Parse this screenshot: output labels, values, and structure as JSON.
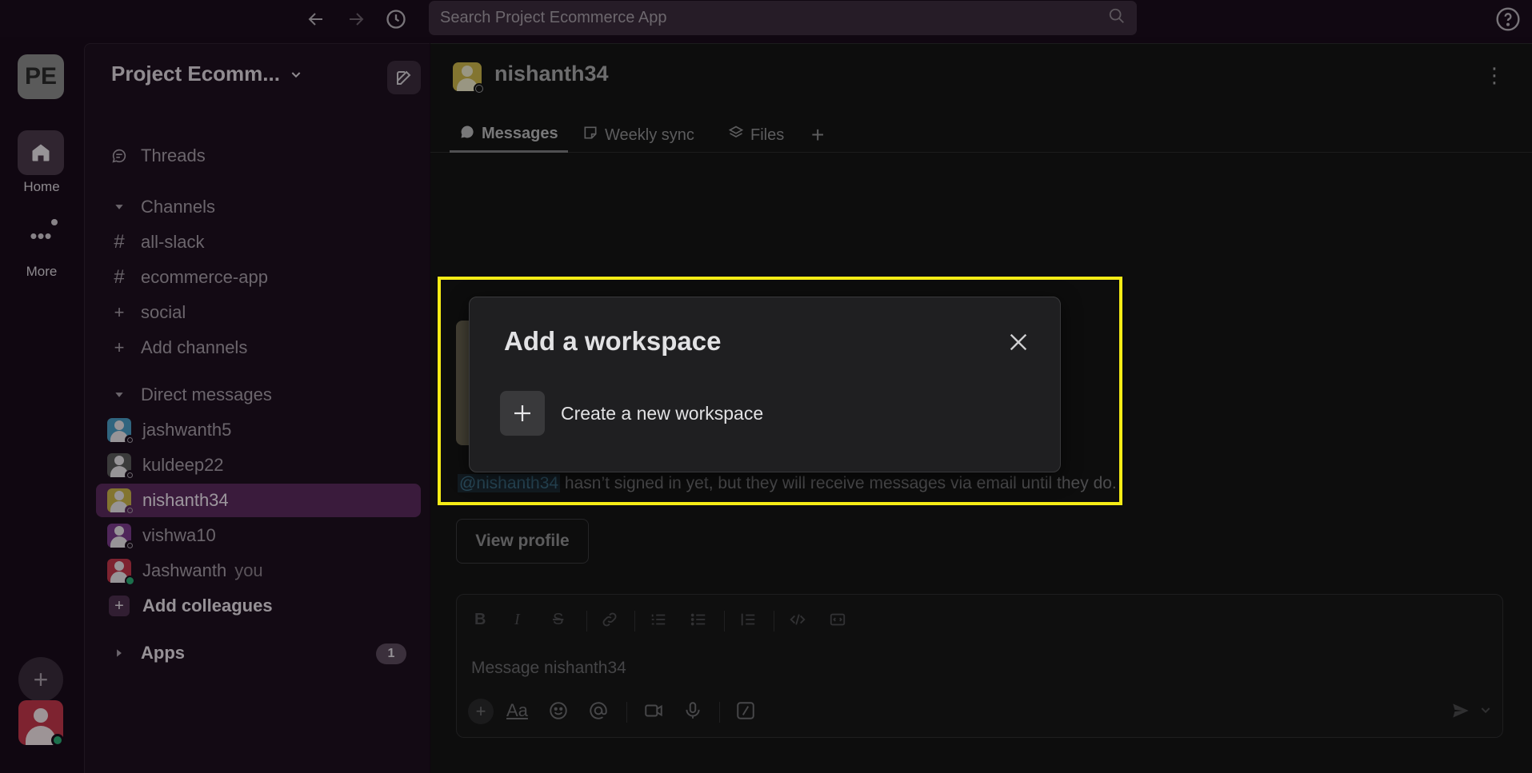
{
  "search": {
    "placeholder": "Search Project Ecommerce App"
  },
  "rail": {
    "workspace_initials": "PE",
    "home_label": "Home",
    "more_label": "More"
  },
  "sidebar": {
    "workspace_name": "Project Ecomm...",
    "threads_label": "Threads",
    "channels_header": "Channels",
    "channels": [
      {
        "prefix": "#",
        "name": "all-slack"
      },
      {
        "prefix": "#",
        "name": "ecommerce-app"
      },
      {
        "prefix": "+",
        "name": "social"
      }
    ],
    "add_channels_label": "Add channels",
    "dm_header": "Direct messages",
    "dms": [
      {
        "name": "jashwanth5",
        "color": "#4a9bc4"
      },
      {
        "name": "kuldeep22",
        "color": "#5b5b5b"
      },
      {
        "name": "nishanth34",
        "color": "#c9b44a"
      },
      {
        "name": "vishwa10",
        "color": "#7a3b8a"
      },
      {
        "name": "Jashwanth",
        "suffix": "you",
        "color": "#c2374b"
      }
    ],
    "add_colleagues_label": "Add colleagues",
    "apps_label": "Apps",
    "apps_badge": "1"
  },
  "channel": {
    "name": "nishanth34",
    "tabs": [
      {
        "label": "Messages",
        "icon": "message-bubble-icon"
      },
      {
        "label": "Weekly sync",
        "icon": "canvas-icon"
      },
      {
        "label": "Files",
        "icon": "layers-icon"
      }
    ],
    "info_mention": "@nishanth34",
    "info_text": " hasn’t signed in yet, but they will receive messages via email until they do.",
    "view_profile_label": "View profile",
    "composer_placeholder": "Message nishanth34"
  },
  "modal": {
    "title": "Add a workspace",
    "create_label": "Create a new workspace"
  },
  "colors": {
    "highlight": "#f5ec16",
    "active_row": "#5a2a5c",
    "online": "#2bac76"
  }
}
